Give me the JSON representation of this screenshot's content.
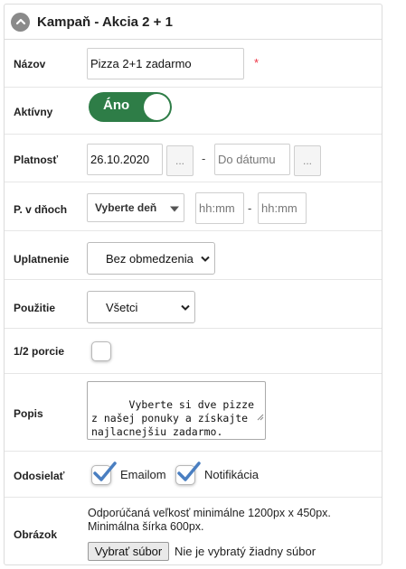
{
  "panel": {
    "title": "Kampaň - Akcia 2 + 1",
    "collapse_icon": "chevron-up-icon"
  },
  "form": {
    "name": {
      "label": "Názov",
      "value": "Pizza 2+1 zadarmo",
      "required_mark": "*"
    },
    "active": {
      "label": "Aktívny",
      "toggle_text": "Áno",
      "state": true,
      "color": "#2e7d47"
    },
    "validity": {
      "label": "Platnosť",
      "from_value": "26.10.2020",
      "picker_label": "...",
      "separator": "-",
      "to_placeholder": "Do dátumu"
    },
    "days": {
      "label": "P. v dňoch",
      "day_select": "Vyberte deň",
      "time_from_placeholder": "hh:mm",
      "separator": "-",
      "time_to_placeholder": "hh:mm"
    },
    "redemption": {
      "label": "Uplatnenie",
      "selected": "Bez obmedzenia"
    },
    "usage": {
      "label": "Použitie",
      "selected": "Všetci"
    },
    "half_portion": {
      "label": "1/2 porcie",
      "checked": false
    },
    "description": {
      "label": "Popis",
      "value": "Vyberte si dve pizze z našej ponuky a získajte najlacnejšiu zadarmo."
    },
    "send": {
      "label": "Odosielať",
      "email_label": "Emailom",
      "email_checked": true,
      "notification_label": "Notifikácia",
      "notification_checked": true,
      "check_color": "#4a7fc1"
    },
    "image": {
      "label": "Obrázok",
      "hint_line1": "Odporúčaná veľkosť minimálne 1200px x 450px.",
      "hint_line2": "Minimálna šírka 600px.",
      "button_label": "Vybrať súbor",
      "file_status": "Nie je vybratý žiadny súbor"
    }
  }
}
